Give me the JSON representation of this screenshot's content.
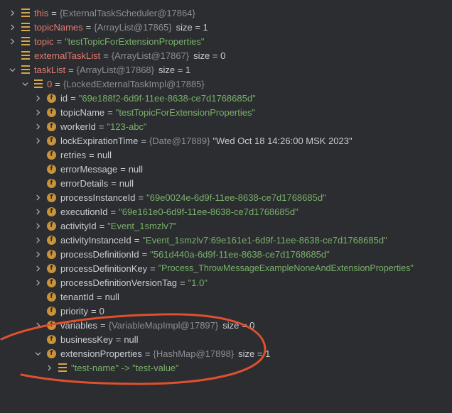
{
  "rows": [
    {
      "name": "this",
      "ref": "{ExternalTaskScheduler@17864}"
    },
    {
      "name": "topicNames",
      "ref": "{ArrayList@17865}",
      "size": "size = 1"
    },
    {
      "name": "topic",
      "str": "\"testTopicForExtensionProperties\""
    },
    {
      "name": "externalTaskList",
      "ref": "{ArrayList@17867}",
      "size": "size = 0"
    },
    {
      "name": "taskList",
      "ref": "{ArrayList@17868}",
      "size": "size = 1"
    },
    {
      "name": "0",
      "ref": "{LockedExternalTaskImpl@17885}"
    },
    {
      "name": "id",
      "str": "\"69e188f2-6d9f-11ee-8638-ce7d1768685d\""
    },
    {
      "name": "topicName",
      "str": "\"testTopicForExtensionProperties\""
    },
    {
      "name": "workerId",
      "str": "\"123-abc\""
    },
    {
      "name": "lockExpirationTime",
      "ref": "{Date@17889}",
      "plain": "\"Wed Oct 18 14:26:00 MSK 2023\""
    },
    {
      "name": "retries",
      "plain": "null"
    },
    {
      "name": "errorMessage",
      "plain": "null"
    },
    {
      "name": "errorDetails",
      "plain": "null"
    },
    {
      "name": "processInstanceId",
      "str": "\"69e0024e-6d9f-11ee-8638-ce7d1768685d\""
    },
    {
      "name": "executionId",
      "str": "\"69e161e0-6d9f-11ee-8638-ce7d1768685d\""
    },
    {
      "name": "activityId",
      "str": "\"Event_1smzlv7\""
    },
    {
      "name": "activityInstanceId",
      "str": "\"Event_1smzlv7:69e161e1-6d9f-11ee-8638-ce7d1768685d\""
    },
    {
      "name": "processDefinitionId",
      "str": "\"561d440a-6d9f-11ee-8638-ce7d1768685d\""
    },
    {
      "name": "processDefinitionKey",
      "str": "\"Process_ThrowMessageExampleNoneAndExtensionProperties\""
    },
    {
      "name": "processDefinitionVersionTag",
      "str": "\"1.0\""
    },
    {
      "name": "tenantId",
      "plain": "null"
    },
    {
      "name": "priority",
      "plain": "0"
    },
    {
      "name": "variables",
      "ref": "{VariableMapImpl@17897}",
      "size": "size = 0"
    },
    {
      "name": "businessKey",
      "plain": "null"
    },
    {
      "name": "extensionProperties",
      "ref": "{HashMap@17898}",
      "size": "size = 1"
    },
    {
      "entry": "\"test-name\" -> \"test-value\""
    }
  ],
  "colors": {
    "background": "#2b2d30",
    "field_name_top": "#e47b72",
    "string_value": "#79b06a",
    "reference": "#8b8e94",
    "annotation": "#e0502e"
  }
}
